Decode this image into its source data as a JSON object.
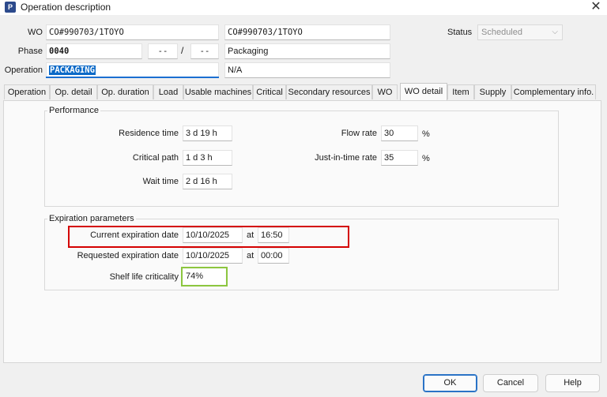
{
  "window": {
    "icon_letter": "P",
    "title": "Operation description"
  },
  "header": {
    "wo_label": "WO",
    "wo_value": "CO#990703/1TOYO",
    "wo_desc": "CO#990703/1TOYO",
    "status_label": "Status",
    "status_value": "Scheduled",
    "phase_label": "Phase",
    "phase_value": "0040",
    "phase_sub1": "--",
    "phase_slash": "/",
    "phase_sub2": "--",
    "phase_desc": "Packaging",
    "operation_label": "Operation",
    "operation_value": "PACKAGING",
    "operation_desc": "N/A"
  },
  "tabs": [
    {
      "label": "Operation"
    },
    {
      "label": "Op. detail"
    },
    {
      "label": "Op. duration"
    },
    {
      "label": "Load"
    },
    {
      "label": "Usable machines"
    },
    {
      "label": "Critical"
    },
    {
      "label": "Secondary resources"
    },
    {
      "label": "WO"
    },
    {
      "label": "WO detail",
      "active": true
    },
    {
      "label": "Item"
    },
    {
      "label": "Supply"
    },
    {
      "label": "Complementary info."
    }
  ],
  "performance": {
    "title": "Performance",
    "residence_label": "Residence time",
    "residence_value": "3 d 19 h",
    "critical_label": "Critical path",
    "critical_value": "1 d 3 h",
    "wait_label": "Wait time",
    "wait_value": "2 d 16 h",
    "flow_label": "Flow rate",
    "flow_value": "30",
    "flow_unit": "%",
    "jit_label": "Just-in-time rate",
    "jit_value": "35",
    "jit_unit": "%"
  },
  "expiration": {
    "title": "Expiration parameters",
    "current_label": "Current expiration date",
    "current_date": "10/10/2025",
    "current_at": "at",
    "current_time": "16:50",
    "requested_label": "Requested expiration date",
    "requested_date": "10/10/2025",
    "requested_at": "at",
    "requested_time": "00:00",
    "shelf_label": "Shelf life criticality",
    "shelf_value": "74%"
  },
  "buttons": {
    "ok": "OK",
    "cancel": "Cancel",
    "help": "Help"
  },
  "colors": {
    "highlight_red": "#d40000",
    "highlight_green": "#8cc63f",
    "selection_blue": "#0b69c7"
  }
}
